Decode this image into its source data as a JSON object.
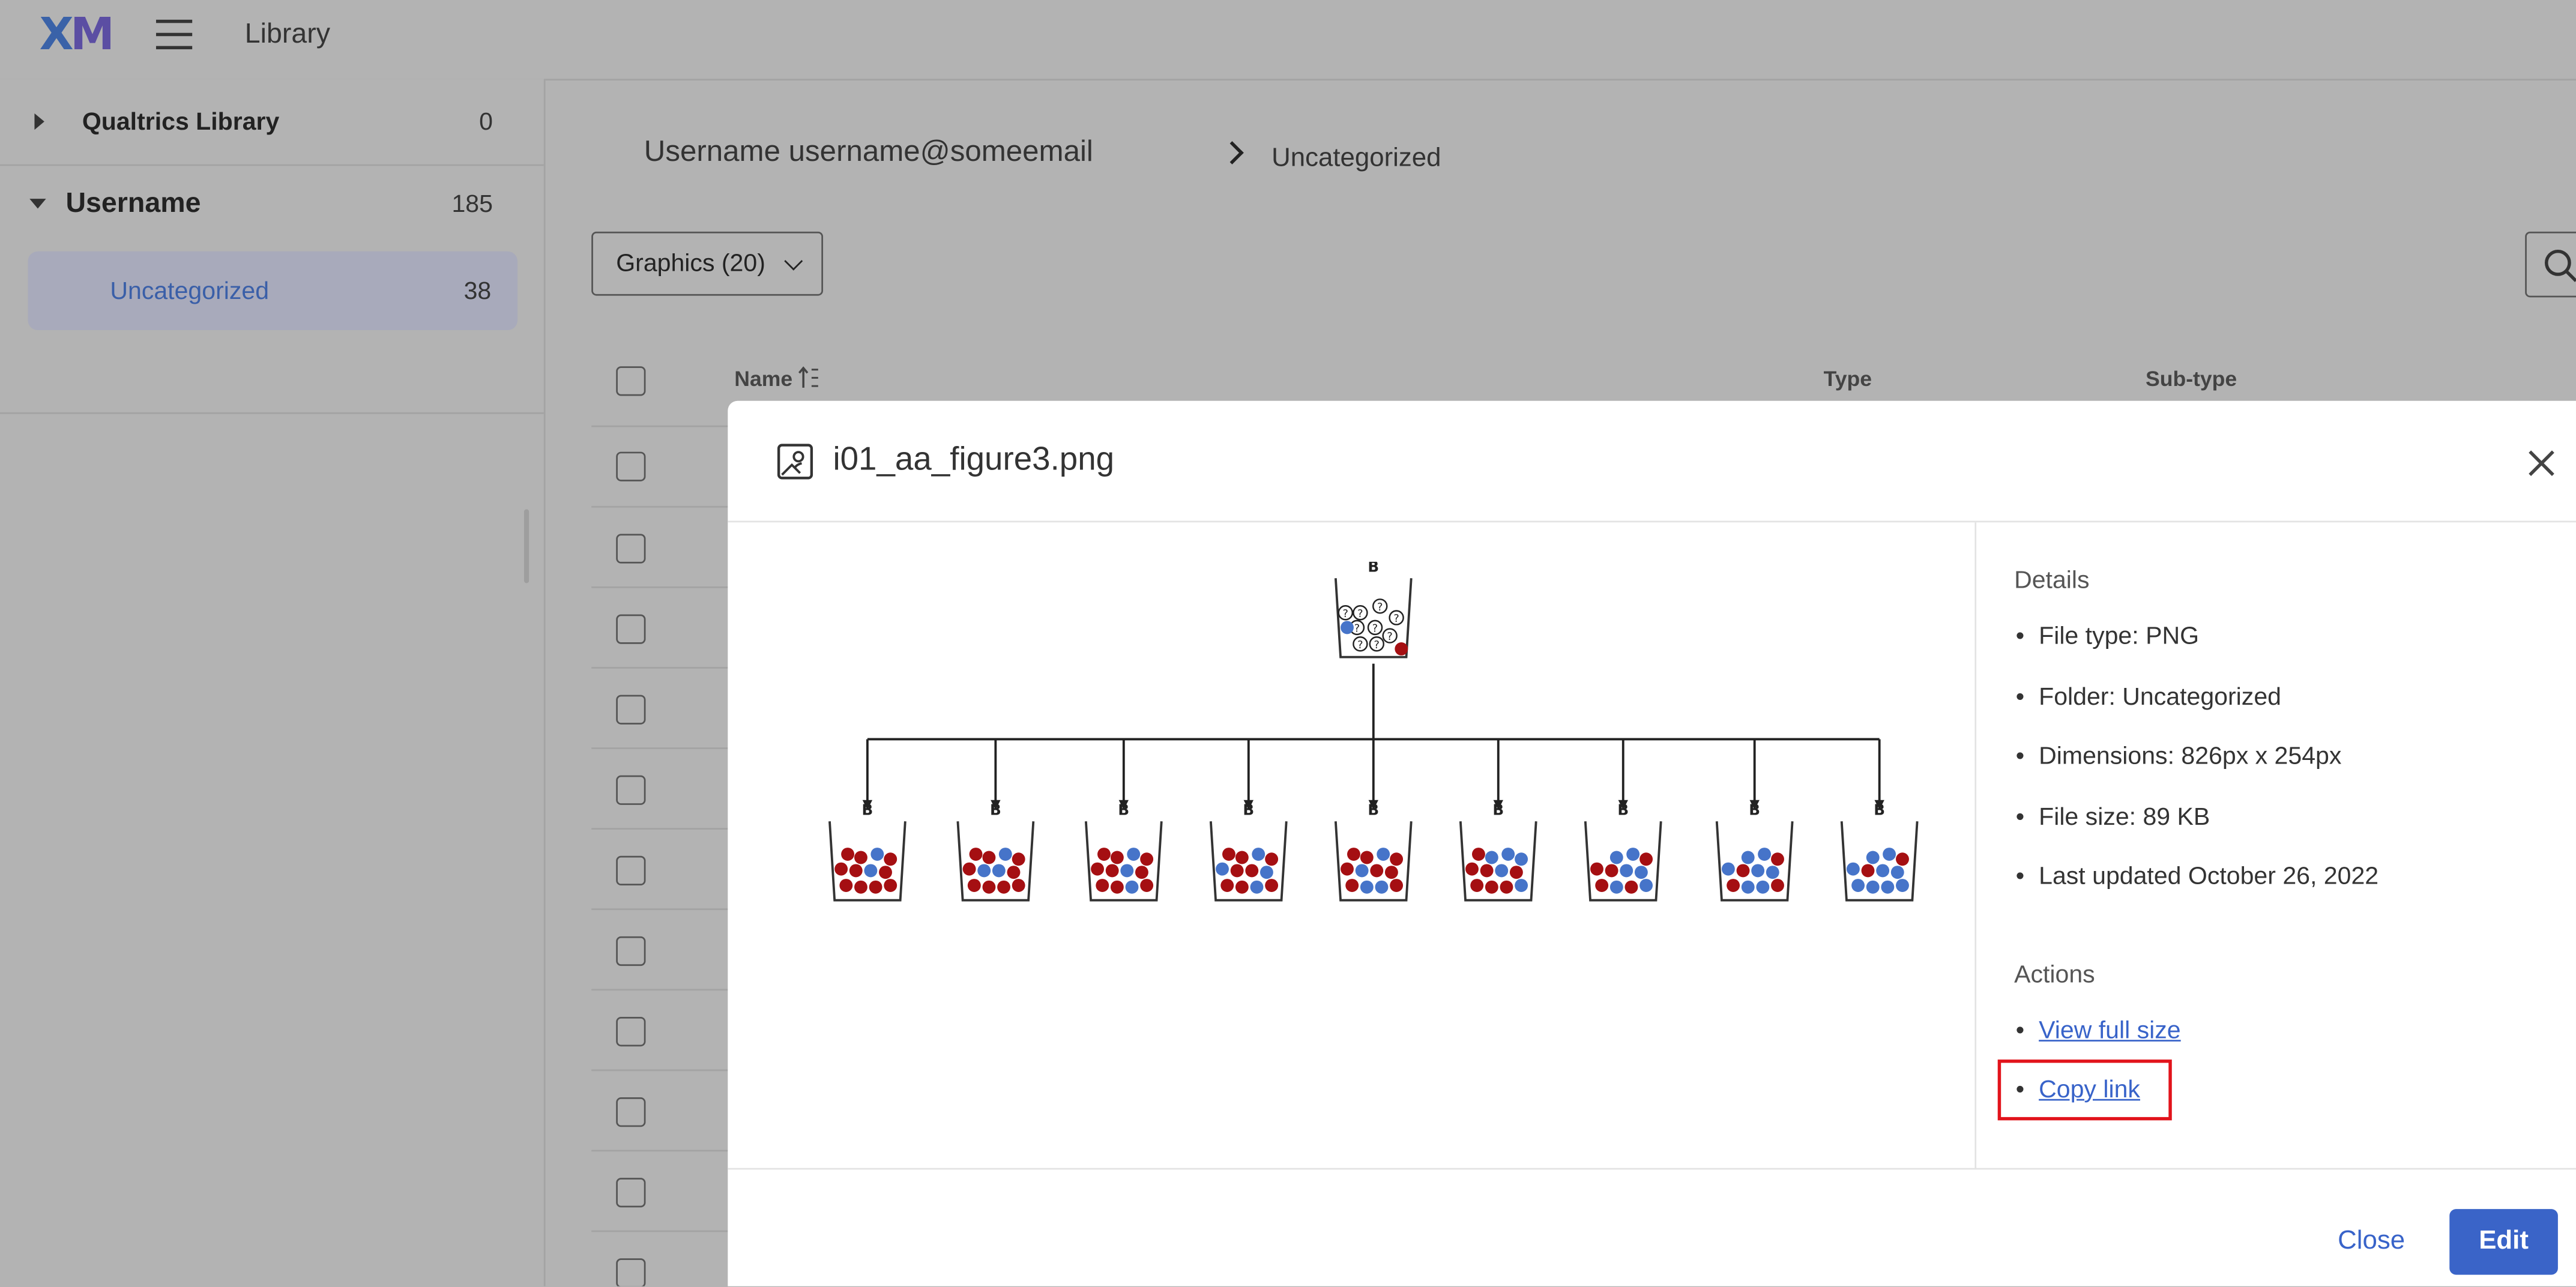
{
  "app": {
    "logo": {
      "x": "X",
      "m": "M"
    },
    "title": "Library"
  },
  "sidebar": {
    "items": [
      {
        "label": "Qualtrics Library",
        "count": "0",
        "expanded": false
      },
      {
        "label": "Username",
        "count": "185",
        "expanded": true
      },
      {
        "label": "Uncategorized",
        "count": "38",
        "selected": true
      }
    ]
  },
  "breadcrumb": {
    "user": "Username username@someemail",
    "folder": "Uncategorized"
  },
  "filter": {
    "label": "Graphics (20)"
  },
  "table": {
    "columns": [
      "Name",
      "Type",
      "Sub-type"
    ],
    "sort_icon": "sort-az-icon"
  },
  "modal": {
    "title": "i01_aa_figure3.png",
    "details_title": "Details",
    "details": [
      "File type: PNG",
      "Folder: Uncategorized",
      "Dimensions: 826px x 254px",
      "File size: 89 KB",
      "Last updated October 26, 2022"
    ],
    "actions_title": "Actions",
    "actions": [
      "View full size",
      "Copy link"
    ],
    "footer": {
      "close": "Close",
      "edit": "Edit"
    },
    "preview": {
      "urn_label": "B",
      "unknown_label": "?"
    }
  },
  "colors": {
    "accent": "#3a64c8",
    "link": "#3863c9",
    "highlight": "#e2131b",
    "red_ball": "#a50f12",
    "blue_ball": "#4674c9"
  }
}
